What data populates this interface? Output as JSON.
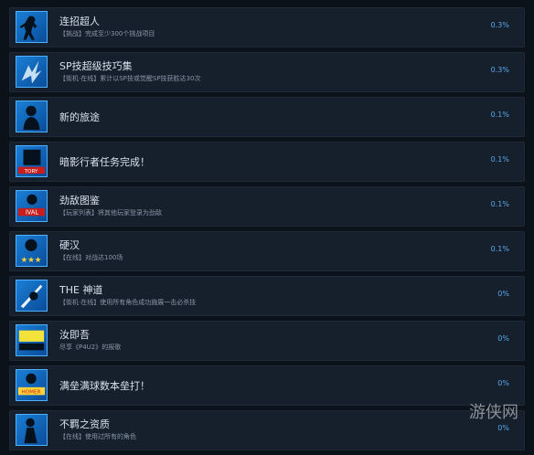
{
  "achievements": [
    {
      "title": "连招超人",
      "desc": "【挑战】完成至少300个挑战项目",
      "pct": "0.3%",
      "icon": "fighter-silhouette-icon"
    },
    {
      "title": "SP技超级技巧集",
      "desc": "【街机·在线】累计以SP技或觉醒SP技获胜达30次",
      "pct": "0.3%",
      "icon": "energy-burst-icon"
    },
    {
      "title": "新的旅途",
      "desc": "",
      "pct": "0.1%",
      "icon": "shadow-figure-icon"
    },
    {
      "title": "暗影行者任务完成！",
      "desc": "",
      "pct": "0.1%",
      "icon": "story-badge-icon"
    },
    {
      "title": "劲敌图鉴",
      "desc": "【玩家列表】将其他玩家登录为劲敌",
      "pct": "0.1%",
      "icon": "rival-badge-icon"
    },
    {
      "title": "硬汉",
      "desc": "【在线】对战达100场",
      "pct": "0.1%",
      "icon": "three-stars-icon"
    },
    {
      "title": "THE 神道",
      "desc": "【街机·在线】使用所有角色成功施展一击必杀技",
      "pct": "0%",
      "icon": "sword-strike-icon"
    },
    {
      "title": "汝即吾",
      "desc": "尽享《P4U2》的报歌",
      "pct": "0%",
      "icon": "p4u2-logo-icon"
    },
    {
      "title": "满垒满球数本垒打！",
      "desc": "",
      "pct": "0%",
      "icon": "homerun-badge-icon"
    },
    {
      "title": "不羁之资质",
      "desc": "【在线】使用过所有的角色",
      "pct": "0%",
      "icon": "character-silhouette-icon"
    }
  ],
  "watermark": "游侠网"
}
